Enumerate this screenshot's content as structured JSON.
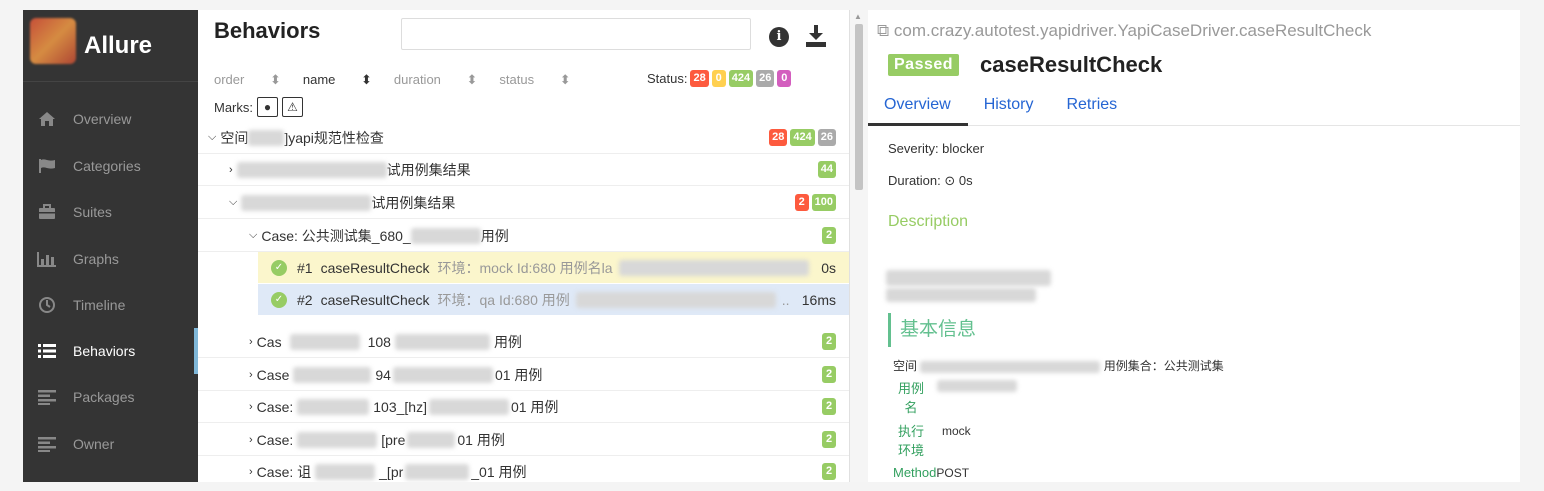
{
  "sidebar": {
    "brand": "Allure",
    "items": [
      {
        "label": "Overview",
        "icon": "home-icon"
      },
      {
        "label": "Categories",
        "icon": "flag-icon"
      },
      {
        "label": "Suites",
        "icon": "briefcase-icon"
      },
      {
        "label": "Graphs",
        "icon": "bar-chart-icon"
      },
      {
        "label": "Timeline",
        "icon": "clock-icon"
      },
      {
        "label": "Behaviors",
        "icon": "list-icon",
        "active": true
      },
      {
        "label": "Packages",
        "icon": "align-left-icon"
      },
      {
        "label": "Owner",
        "icon": "align-left-icon"
      }
    ]
  },
  "behaviors": {
    "title": "Behaviors",
    "search_value": "",
    "sort": {
      "order": "order",
      "name": "name",
      "duration": "duration",
      "status": "status"
    },
    "status_label": "Status:",
    "status_counts": {
      "failed": "28",
      "broken": "0",
      "passed": "424",
      "skipped": "26",
      "unknown": "0"
    },
    "marks_label": "Marks:",
    "tree": {
      "root": {
        "label_prefix": "空间",
        "label_suffix": "]yapi规范性检查",
        "counts": [
          "28",
          "424",
          "26"
        ]
      },
      "group1": {
        "label_suffix": "试用例集结果",
        "counts": [
          "44"
        ]
      },
      "group2": {
        "label_suffix": "试用例集结果",
        "counts": [
          "2",
          "100"
        ]
      },
      "case1": {
        "prefix": "Case: 公共测试集_680_",
        "suffix": "用例",
        "count": "2"
      },
      "tests": [
        {
          "num": "#1",
          "name": "caseResultCheck",
          "env": "环境：mock Id:680 用例名la",
          "duration": "0s"
        },
        {
          "num": "#2",
          "name": "caseResultCheck",
          "env": "环境：qa Id:680 用例",
          "ellipsis": "..",
          "duration": "16ms"
        }
      ],
      "cases": [
        {
          "p1": "Cas",
          "p2": "108",
          "p3": "用例",
          "count": "2"
        },
        {
          "p1": "Case",
          "p2": "94",
          "p3": "01 用例",
          "count": "2"
        },
        {
          "p1": "Case: ",
          "p2": "103_[hz]",
          "p3": "01 用例",
          "count": "2"
        },
        {
          "p1": "Case: ",
          "p2": "[pre",
          "p3": "01 用例",
          "count": "2"
        },
        {
          "p1": "Case: 诅",
          "p2": "_[pr",
          "p3": "_01 用例",
          "count": "2"
        }
      ]
    }
  },
  "detail": {
    "full_name": "com.crazy.autotest.yapidriver.YapiCaseDriver.caseResultCheck",
    "status": "Passed",
    "name": "caseResultCheck",
    "tabs": [
      "Overview",
      "History",
      "Retries"
    ],
    "severity": "Severity: blocker",
    "duration_label": "Duration:",
    "duration_value": "0s",
    "description_label": "Description",
    "section_title": "基本信息",
    "info": {
      "space_prefix": "空间",
      "space_suffix": "用例集合：公共测试集",
      "case_name_key": "用例名",
      "env_key": "执行环境",
      "env_value": "mock",
      "method_key": "Method",
      "method_value": "POST"
    }
  }
}
